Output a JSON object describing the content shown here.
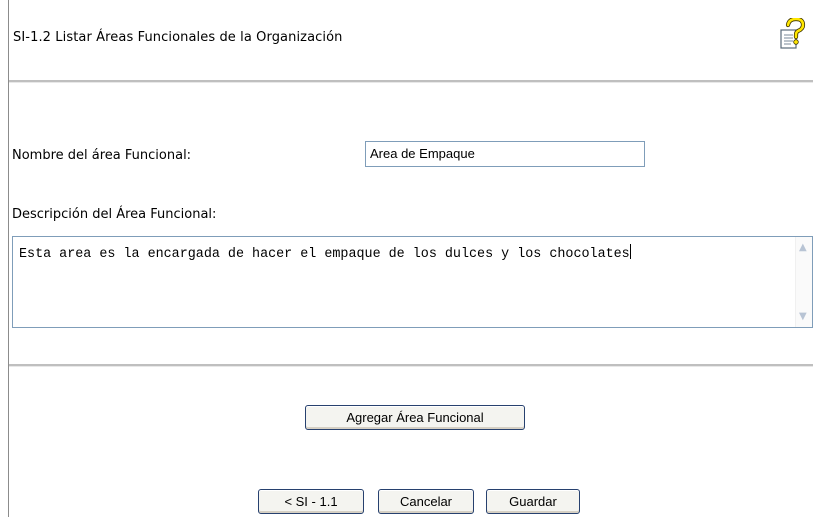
{
  "header": {
    "title": "SI-1.2 Listar Áreas Funcionales de la Organización",
    "help_icon": "help-question-icon"
  },
  "form": {
    "name_label": "Nombre del área Funcional:",
    "name_value": "Area de Empaque",
    "description_label": "Descripción del Área Funcional:",
    "description_value": "Esta area es la encargada de hacer el empaque de los dulces y los chocolates"
  },
  "actions": {
    "add_label": "Agregar Área Funcional",
    "back_label": "< SI - 1.1",
    "cancel_label": "Cancelar",
    "save_label": "Guardar"
  }
}
